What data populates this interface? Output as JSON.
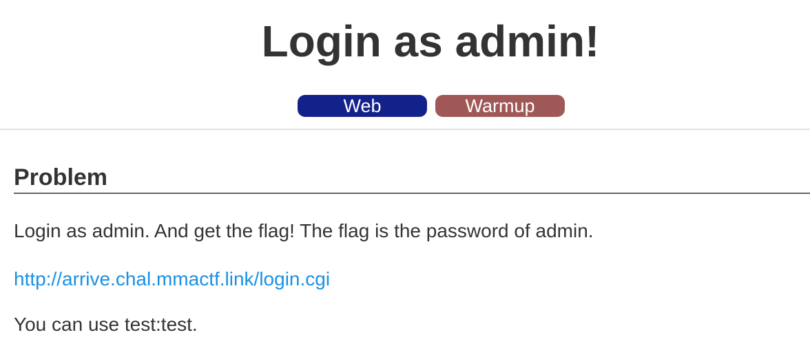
{
  "header": {
    "title": "Login as admin!",
    "tags": [
      {
        "label": "Web",
        "color": "#13218a"
      },
      {
        "label": "Warmup",
        "color": "#a05857"
      }
    ]
  },
  "problem": {
    "heading": "Problem",
    "description": "Login as admin. And get the flag! The flag is the password of admin.",
    "link_text": "http://arrive.chal.mmactf.link/login.cgi",
    "credentials_text": "You can use test:test."
  },
  "colors": {
    "link": "#1a90e3",
    "text": "#333333",
    "divider": "#e2e2e2"
  }
}
